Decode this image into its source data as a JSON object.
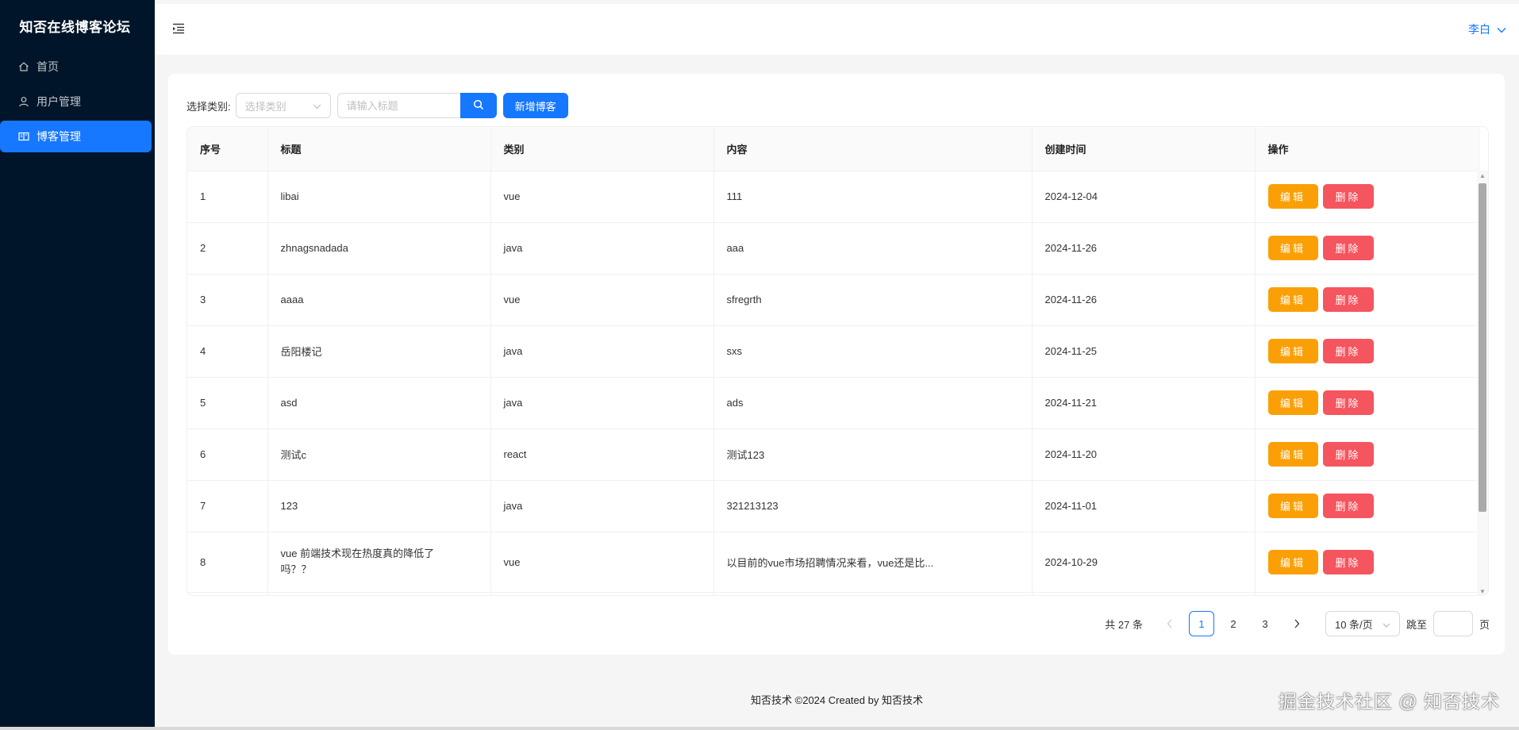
{
  "app": {
    "title": "知否在线博客论坛",
    "footer": "知否技术 ©2024 Created by 知否技术",
    "watermark": "掘金技术社区 @ 知否技术"
  },
  "sidebar": {
    "items": [
      {
        "label": "首页",
        "icon": "home-icon"
      },
      {
        "label": "用户管理",
        "icon": "user-icon"
      },
      {
        "label": "博客管理",
        "icon": "book-icon",
        "active": true
      }
    ]
  },
  "header": {
    "username": "李白"
  },
  "toolbar": {
    "category_label": "选择类别:",
    "category_placeholder": "选择类别",
    "search_placeholder": "请输入标题",
    "add_label": "新增博客"
  },
  "table": {
    "columns": [
      "序号",
      "标题",
      "类别",
      "内容",
      "创建时间",
      "操作"
    ],
    "rows": [
      {
        "no": "1",
        "title": "libai",
        "category": "vue",
        "content": "111",
        "created": "2024-12-04"
      },
      {
        "no": "2",
        "title": "zhnagsnadada",
        "category": "java",
        "content": "aaa",
        "created": "2024-11-26"
      },
      {
        "no": "3",
        "title": "aaaa",
        "category": "vue",
        "content": "sfregrth",
        "created": "2024-11-26"
      },
      {
        "no": "4",
        "title": "岳阳楼记",
        "category": "java",
        "content": "sxs",
        "created": "2024-11-25"
      },
      {
        "no": "5",
        "title": "asd",
        "category": "java",
        "content": "ads",
        "created": "2024-11-21"
      },
      {
        "no": "6",
        "title": "测试c",
        "category": "react",
        "content": "测试123",
        "created": "2024-11-20"
      },
      {
        "no": "7",
        "title": "123",
        "category": "java",
        "content": "321213123",
        "created": "2024-11-01"
      },
      {
        "no": "8",
        "title": "vue 前端技术现在热度真的降低了吗？？",
        "category": "vue",
        "content": "以目前的vue市场招聘情况来看，vue还是比...",
        "created": "2024-10-29"
      }
    ],
    "edit_label": "编辑",
    "delete_label": "删除"
  },
  "pagination": {
    "total_text": "共 27 条",
    "pages": [
      "1",
      "2",
      "3"
    ],
    "current": "1",
    "page_size": "10 条/页",
    "jump_label": "跳至",
    "page_suffix": "页"
  },
  "colors": {
    "sidebar_bg": "#001529",
    "primary": "#1677ff",
    "edit": "#faa006",
    "delete": "#f5555e"
  }
}
